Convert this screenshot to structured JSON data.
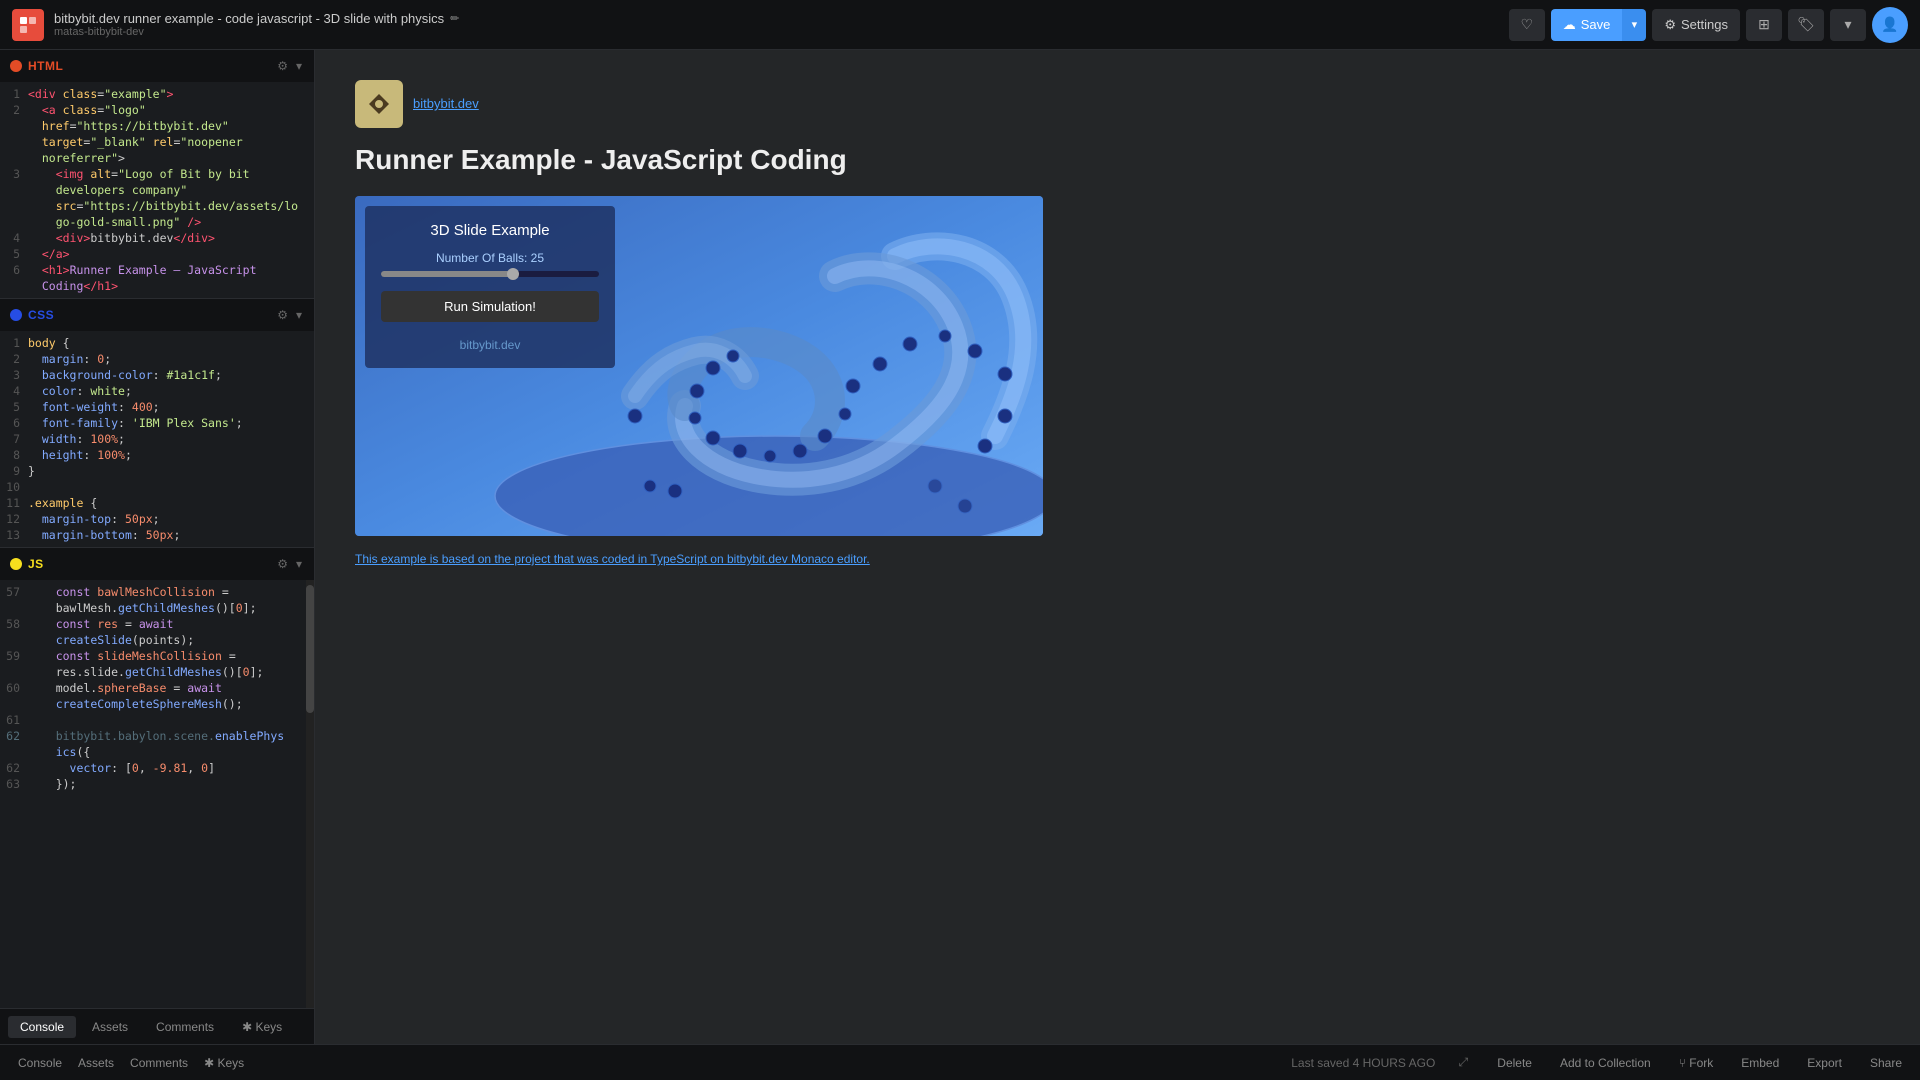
{
  "topbar": {
    "logo_text": "bb",
    "title": "bitbybit.dev runner example - code javascript - 3D slide with physics",
    "pencil": "✏",
    "subtitle": "matas-bitbybit-dev",
    "save_label": "Save",
    "save_icon": "☁",
    "settings_label": "Settings",
    "settings_icon": "⚙",
    "heart_icon": "♡",
    "grid_icon": "⊞",
    "bookmark_icon": "🔖",
    "chevron_icon": "▾",
    "avatar_icon": "👤"
  },
  "html_section": {
    "label": "HTML",
    "lines": [
      {
        "num": "1",
        "content": "<div class=\"example\">"
      },
      {
        "num": "2",
        "content": "  <a class=\"logo\""
      },
      {
        "num": "",
        "content": "  href=\"https://bitbybit.dev\""
      },
      {
        "num": "",
        "content": "  target=\"_blank\" rel=\"noopener"
      },
      {
        "num": "",
        "content": "  noreferrer\">"
      },
      {
        "num": "3",
        "content": "    <img alt=\"Logo of Bit by bit"
      },
      {
        "num": "",
        "content": "    developers company\""
      },
      {
        "num": "",
        "content": "    src=\"https://bitbybit.dev/assets/lo"
      },
      {
        "num": "",
        "content": "    go-gold-small.png\" />"
      },
      {
        "num": "4",
        "content": "    <div>bitbybit.dev</div>"
      },
      {
        "num": "5",
        "content": "  </a>"
      },
      {
        "num": "6",
        "content": "  <h1>Runner Example – JavaScript"
      },
      {
        "num": "",
        "content": "  Coding</h1>"
      }
    ]
  },
  "css_section": {
    "label": "CSS",
    "lines": [
      {
        "num": "1",
        "content": "body {"
      },
      {
        "num": "2",
        "content": "  margin: 0;"
      },
      {
        "num": "3",
        "content": "  background-color: #1a1c1f;"
      },
      {
        "num": "4",
        "content": "  color: white;"
      },
      {
        "num": "5",
        "content": "  font-weight: 400;"
      },
      {
        "num": "6",
        "content": "  font-family: 'IBM Plex Sans';"
      },
      {
        "num": "7",
        "content": "  width: 100%;"
      },
      {
        "num": "8",
        "content": "  height: 100%;"
      },
      {
        "num": "9",
        "content": "}"
      },
      {
        "num": "10",
        "content": ""
      },
      {
        "num": "11",
        "content": ".example {"
      },
      {
        "num": "12",
        "content": "  margin-top: 50px;"
      },
      {
        "num": "13",
        "content": "  margin-bottom: 50px;"
      }
    ]
  },
  "js_section": {
    "label": "JS",
    "lines": [
      {
        "num": "57",
        "content": "    const bawlMeshCollision ="
      },
      {
        "num": "",
        "content": "    bawlMesh.getChildMeshes()[0];"
      },
      {
        "num": "58",
        "content": "    const res = await"
      },
      {
        "num": "",
        "content": "    createSlide(points);"
      },
      {
        "num": "59",
        "content": "    const slideMeshCollision ="
      },
      {
        "num": "",
        "content": "    res.slide.getChildMeshes()[0];"
      },
      {
        "num": "60",
        "content": "    model.sphereBase = await"
      },
      {
        "num": "",
        "content": "    createCompleteSphereMesh();"
      },
      {
        "num": "61",
        "content": ""
      },
      {
        "num": "62",
        "content": "    bitbybit.babylon.scene.enablePhys"
      },
      {
        "num": "",
        "content": "    ics({"
      },
      {
        "num": "62",
        "content": "      vector: [0, -9.81, 0]"
      },
      {
        "num": "63",
        "content": "    });"
      }
    ]
  },
  "bottom_tabs": {
    "items": [
      {
        "label": "Console",
        "active": true
      },
      {
        "label": "Assets",
        "active": false
      },
      {
        "label": "Comments",
        "active": false
      },
      {
        "label": "✱ Keys",
        "active": false
      }
    ]
  },
  "preview": {
    "source_name": "bitbybit.dev",
    "title": "Runner Example - JavaScript Coding",
    "sim_panel": {
      "title": "3D Slide Example",
      "balls_label": "Number Of Balls: 25",
      "run_button": "Run Simulation!",
      "brand": "bitbybit.dev"
    },
    "preview_link": "This example is based on the project that was coded in TypeScript on bitbybit.dev Monaco editor."
  },
  "status_bar": {
    "last_saved": "Last saved 4 HOURS AGO",
    "open_icon": "⤢",
    "delete_label": "Delete",
    "add_collection_label": "Add to Collection",
    "fork_icon": "⑂",
    "fork_label": "Fork",
    "embed_label": "Embed",
    "export_label": "Export",
    "share_label": "Share"
  }
}
